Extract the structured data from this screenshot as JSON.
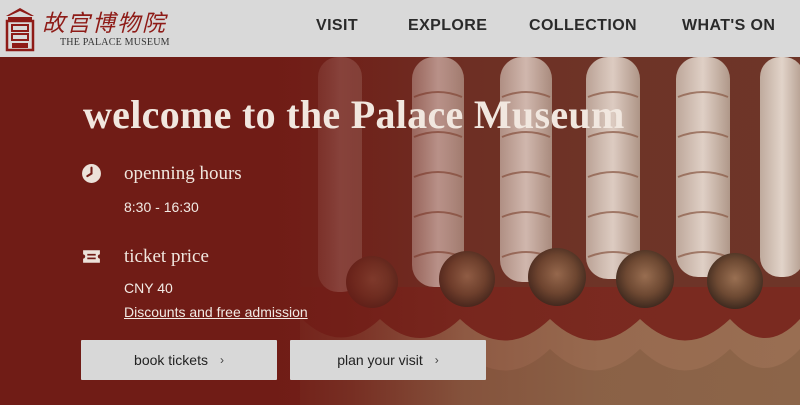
{
  "header": {
    "logo_cn": "故宫博物院",
    "logo_en": "THE PALACE MUSEUM",
    "nav": {
      "visit": "VISIT",
      "explore": "EXPLORE",
      "collection": "COLLECTION",
      "whats_on": "WHAT'S ON"
    }
  },
  "hero": {
    "title": "welcome to the Palace Museum",
    "hours": {
      "icon": "clock-icon",
      "label": "openning hours",
      "value": "8:30 - 16:30"
    },
    "price": {
      "icon": "ticket-icon",
      "label": "ticket price",
      "value": "CNY 40",
      "link": "Discounts and free admission"
    },
    "buttons": {
      "book": "book tickets",
      "plan": "plan your visit",
      "arrow": "›"
    }
  },
  "colors": {
    "brand_red": "#8e1b17",
    "hero_red": "#701c16",
    "header_bg": "#d9d9d9",
    "button_bg": "#d8d8d8"
  }
}
